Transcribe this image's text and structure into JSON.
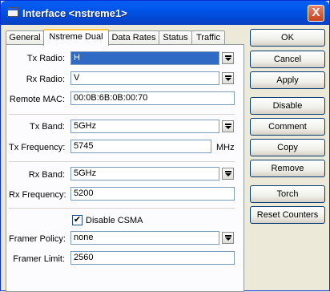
{
  "window": {
    "title": "Interface <nstreme1>",
    "close_label": "X"
  },
  "tabs": [
    {
      "label": "General"
    },
    {
      "label": "Nstreme Dual"
    },
    {
      "label": "Data Rates"
    },
    {
      "label": "Status"
    },
    {
      "label": "Traffic"
    }
  ],
  "active_tab": "Nstreme Dual",
  "form": {
    "tx_radio": {
      "label": "Tx Radio:",
      "value": "H"
    },
    "rx_radio": {
      "label": "Rx Radio:",
      "value": "V"
    },
    "remote_mac": {
      "label": "Remote MAC:",
      "value": "00:0B:6B:0B:00:70"
    },
    "tx_band": {
      "label": "Tx Band:",
      "value": "5GHz"
    },
    "tx_frequency": {
      "label": "Tx Frequency:",
      "value": "5745",
      "unit": "MHz"
    },
    "rx_band": {
      "label": "Rx Band:",
      "value": "5GHz"
    },
    "rx_frequency": {
      "label": "Rx Frequency:",
      "value": "5200"
    },
    "disable_csma": {
      "label": "Disable CSMA",
      "checked": true,
      "mark": "✔"
    },
    "framer_policy": {
      "label": "Framer Policy:",
      "value": "none"
    },
    "framer_limit": {
      "label": "Framer Limit:",
      "value": "2560"
    }
  },
  "buttons": {
    "ok": "OK",
    "cancel": "Cancel",
    "apply": "Apply",
    "disable": "Disable",
    "comment": "Comment",
    "copy": "Copy",
    "remove": "Remove",
    "torch": "Torch",
    "reset_counters": "Reset Counters"
  }
}
